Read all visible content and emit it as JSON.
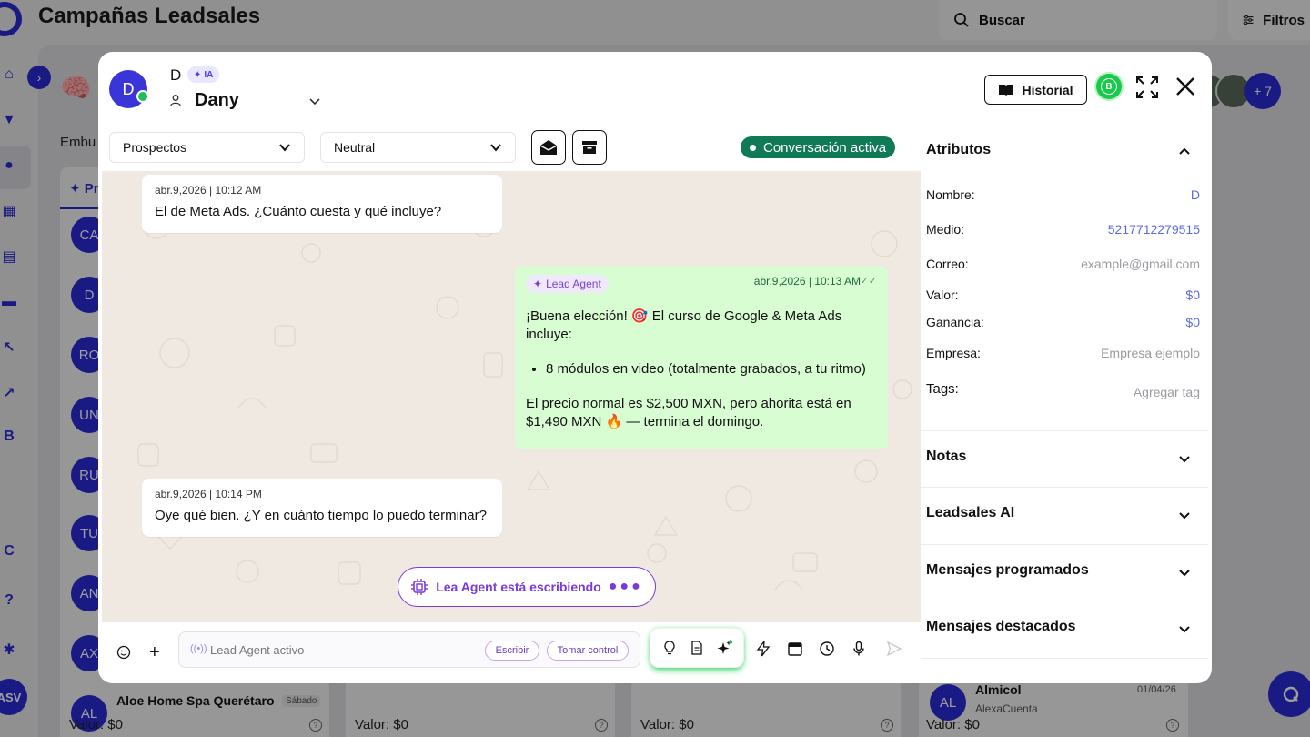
{
  "app": {
    "title": "Campañas Leadsales",
    "search_label": "Buscar",
    "filters_label": "Filtros",
    "stage_title_partial": "Embu",
    "tab_partial": "Pr",
    "user_initials": "ASV",
    "side_letter_b": "B",
    "side_letter_c": "C",
    "team_more": "+ 7",
    "lead_initials": [
      "CA",
      "D",
      "RO",
      "UN",
      "RU",
      "TU",
      "AN",
      "AX",
      "AL"
    ],
    "cards": {
      "aloe_title": "Aloe Home Spa Querétaro",
      "aloe_day": "Sábado",
      "valor_labels": [
        "Valor:  $0",
        "Valor:  $0",
        "Valor:  $0",
        "Valor:  $0"
      ],
      "almicol_name": "Almicol",
      "almicol_sub": "AlexaCuenta",
      "almicol_date": "01/04/26",
      "almicol_initials": "AL"
    }
  },
  "modal": {
    "contact": {
      "avatar_letter": "D",
      "short_name": "D",
      "ia_badge": "IA",
      "name": "Dany"
    },
    "historial_label": "Historial",
    "b_badge": "B",
    "filters": {
      "stage_selected": "Prospectos",
      "sentiment_selected": "Neutral"
    },
    "status_label": "Conversación activa",
    "messages": [
      {
        "time": "abr.9,2026 | 10:12 AM",
        "text": "El de Meta Ads. ¿Cuánto cuesta y qué incluye?"
      },
      {
        "agent": "Lead Agent",
        "time": "abr.9,2026 | 10:13 AM",
        "intro": "¡Buena elección! 🎯 El curso de Google & Meta Ads incluye:",
        "bullet": "8 módulos en video (totalmente grabados, a tu ritmo)",
        "price": "El precio normal es $2,500 MXN, pero ahorita está en $1,490 MXN 🔥 — termina el domingo."
      },
      {
        "time": "abr.9,2026 | 10:14 PM",
        "text": "Oye qué bien. ¿Y en cuánto tiempo lo puedo terminar?"
      }
    ],
    "typing_label": "Lea Agent está escribiendo",
    "typing_dots": "●●●",
    "input": {
      "placeholder": "Lead Agent activo",
      "write_label": "Escribir",
      "take_control_label": "Tomar control"
    },
    "attributes": {
      "section_title": "Atributos",
      "rows": [
        {
          "label": "Nombre:",
          "value": "D"
        },
        {
          "label": "Medio:",
          "value": "5217712279515"
        },
        {
          "label": "Correo:",
          "value": "example@gmail.com"
        },
        {
          "label": "Valor:",
          "value": "$0"
        },
        {
          "label": "Ganancia:",
          "value": "$0"
        },
        {
          "label": "Empresa:",
          "value": "Empresa ejemplo"
        },
        {
          "label": "Tags:",
          "value": "Agregar tag"
        }
      ]
    },
    "sections": [
      "Notas",
      "Leadsales AI",
      "Mensajes programados",
      "Mensajes destacados"
    ]
  }
}
